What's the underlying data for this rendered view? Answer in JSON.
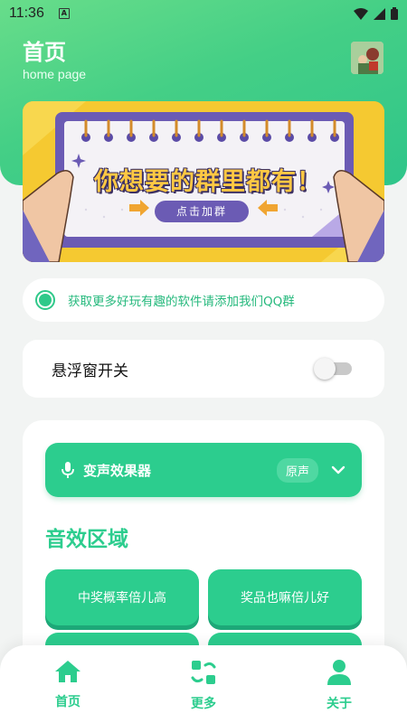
{
  "status_bar": {
    "time": "11:36",
    "a_label": "A"
  },
  "header": {
    "title": "首页",
    "subtitle": "home page"
  },
  "banner": {
    "headline": "你想要的群里都有！",
    "button_label": "点击加群"
  },
  "notice": {
    "text": "获取更多好玩有趣的软件请添加我们QQ群"
  },
  "float_window": {
    "label": "悬浮窗开关",
    "enabled": false
  },
  "voice_effect": {
    "label": "变声效果器",
    "chip": "原声"
  },
  "section": {
    "title": "音效区域"
  },
  "effects": [
    {
      "label": "中奖概率倍儿高"
    },
    {
      "label": "奖品也嘛倍儿好"
    },
    {
      "label": ""
    },
    {
      "label": ""
    }
  ],
  "nav": {
    "items": [
      {
        "label": "首页",
        "icon": "home-icon"
      },
      {
        "label": "更多",
        "icon": "apps-icon"
      },
      {
        "label": "关于",
        "icon": "person-icon"
      }
    ]
  },
  "colors": {
    "accent": "#2ccd8e",
    "header_gradient_start": "#68dd8a",
    "header_gradient_end": "#2fc58a"
  }
}
